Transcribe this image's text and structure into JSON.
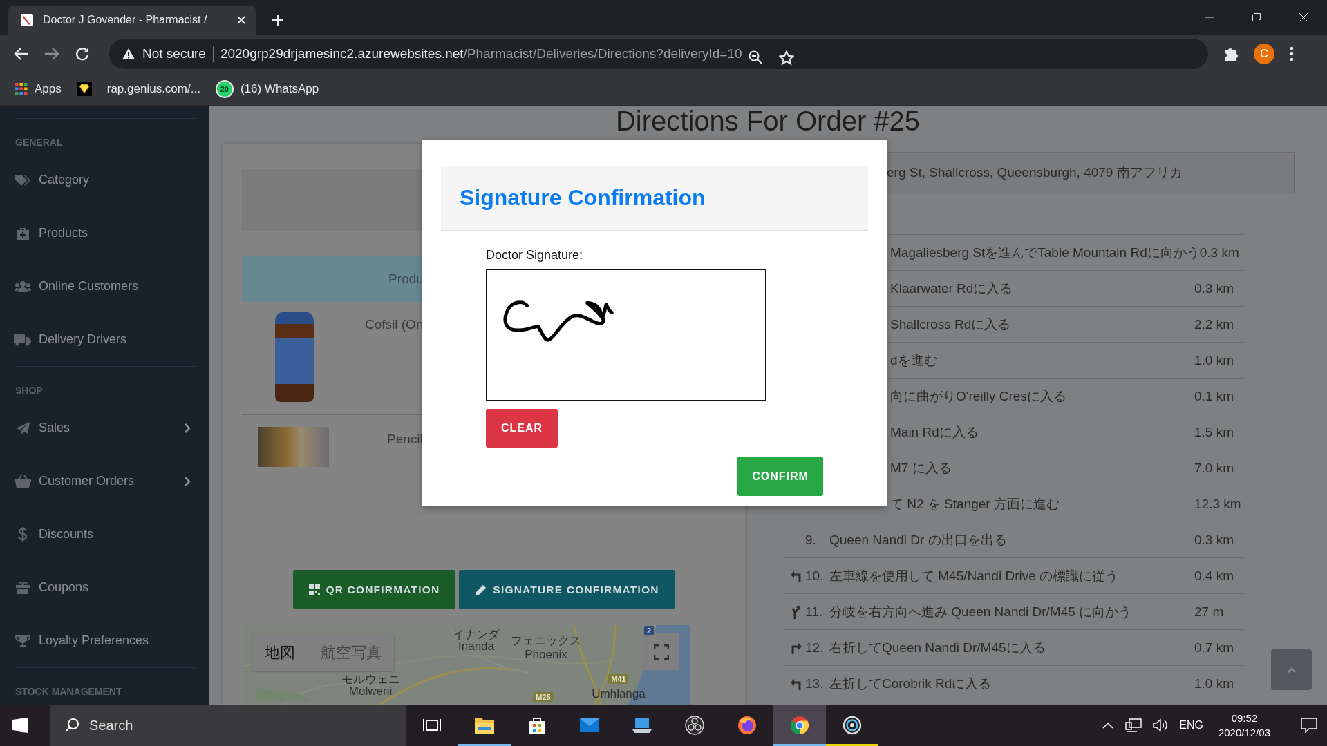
{
  "browser": {
    "tab": {
      "title": "Doctor J Govender - Pharmacist /",
      "selected": true
    },
    "security": "Not secure",
    "url_host": "2020grp29drjamesinc2.azurewebsites.net",
    "url_path": "/Pharmacist/Deliveries/Directions?deliveryId=10",
    "profile_initial": "C",
    "bookmarks": [
      {
        "kind": "apps",
        "label": "Apps"
      },
      {
        "kind": "gem"
      },
      {
        "kind": "page",
        "label": "rap.genius.com/..."
      },
      {
        "kind": "whatsapp",
        "badge": "20",
        "label": "(16) WhatsApp"
      }
    ]
  },
  "sidebar": {
    "sections": [
      {
        "title": "GENERAL",
        "items": [
          {
            "label": "Category",
            "has_submenu": false
          },
          {
            "label": "Products",
            "has_submenu": false
          },
          {
            "label": "Online Customers",
            "has_submenu": false
          },
          {
            "label": "Delivery Drivers",
            "has_submenu": false
          }
        ]
      },
      {
        "title": "SHOP",
        "items": [
          {
            "label": "Sales",
            "has_submenu": true
          },
          {
            "label": "Customer Orders",
            "has_submenu": true
          },
          {
            "label": "Discounts",
            "has_submenu": false
          },
          {
            "label": "Coupons",
            "has_submenu": false
          },
          {
            "label": "Loyalty Preferences",
            "has_submenu": false
          }
        ]
      },
      {
        "title": "STOCK MANAGEMENT"
      }
    ]
  },
  "page": {
    "title": "Directions For Order #25",
    "products": {
      "header": "Produ",
      "rows": [
        {
          "name": "Cofsil (On"
        },
        {
          "name": "Pencil"
        }
      ]
    },
    "actions": [
      {
        "kind": "qr",
        "label": "QR CONFIRMATION"
      },
      {
        "kind": "signature",
        "label": "SIGNATURE CONFIRMATION"
      }
    ],
    "map": {
      "map_types": [
        {
          "label": "地図",
          "selected": true
        },
        {
          "label": "航空写真",
          "selected": false
        }
      ],
      "places": [
        {
          "name": "イナンダ"
        },
        {
          "name": "Inanda"
        },
        {
          "name": "フェニックス"
        },
        {
          "name": "Phoenix"
        },
        {
          "name": "モルウェニ"
        },
        {
          "name": "Molweni"
        },
        {
          "name": "Umhlanga"
        }
      ],
      "shields": [
        {
          "kind": "national",
          "text": "2"
        },
        {
          "kind": "metro",
          "text": "M41"
        },
        {
          "kind": "metro",
          "text": "M25"
        }
      ]
    },
    "directions": {
      "address": "erg St, Shallcross, Queensburgh, 4079 南アフリカ",
      "steps": [
        {
          "text": "Magaliesberg Stを進んでTable Mountain Rdに向かう",
          "distance": "0.3 km"
        },
        {
          "text": "Klaarwater Rdに入る",
          "distance": "0.3 km"
        },
        {
          "text": "Shallcross Rdに入る",
          "distance": "2.2 km"
        },
        {
          "text": "dを進む",
          "distance": "1.0 km"
        },
        {
          "text": "向に曲がりO'reilly Cresに入る",
          "distance": "0.1 km"
        },
        {
          "text": "Main Rdに入る",
          "distance": "1.5 km"
        },
        {
          "text": "M7 に入る",
          "distance": "7.0 km"
        },
        {
          "text": "て N2 を Stanger 方面に進む",
          "distance": "12.3 km"
        },
        {
          "number": "9.",
          "kind": "plain",
          "text": "Queen Nandi Dr の出口を出る",
          "distance": "0.3 km"
        },
        {
          "number": "10.",
          "kind": "keep-left",
          "text": "左車線を使用して M45/Nandi Drive の標識に従う",
          "distance": "0.4 km"
        },
        {
          "number": "11.",
          "kind": "fork-right",
          "text": "分岐を右方向へ進み Queen Nandi Dr/M45 に向かう",
          "distance": "27 m"
        },
        {
          "number": "12.",
          "kind": "turn-right",
          "text": "右折してQueen Nandi Dr/M45に入る",
          "distance": "0.7 km"
        },
        {
          "number": "13.",
          "kind": "turn-left",
          "text": "左折してCorobrik Rdに入る",
          "distance": "1.0 km"
        }
      ]
    }
  },
  "modal": {
    "title": "Signature Confirmation",
    "field_label": "Doctor Signature:",
    "clear": "CLEAR",
    "confirm": "CONFIRM"
  },
  "taskbar": {
    "search": "Search",
    "apps": [
      {
        "kind": "taskview",
        "selected": false
      },
      {
        "kind": "explorer",
        "selected": false,
        "color": "#76b9ed"
      },
      {
        "kind": "store",
        "selected": false
      },
      {
        "kind": "mail",
        "selected": false
      },
      {
        "kind": "laptop",
        "selected": false
      },
      {
        "kind": "obs",
        "selected": false
      },
      {
        "kind": "firefox",
        "selected": false
      },
      {
        "kind": "chrome",
        "selected": true,
        "color": "#76b9ed"
      },
      {
        "kind": "spiral",
        "selected": false,
        "color": "#e8d400"
      }
    ],
    "language": "ENG",
    "time": "09:52",
    "date": "2020/12/03"
  }
}
